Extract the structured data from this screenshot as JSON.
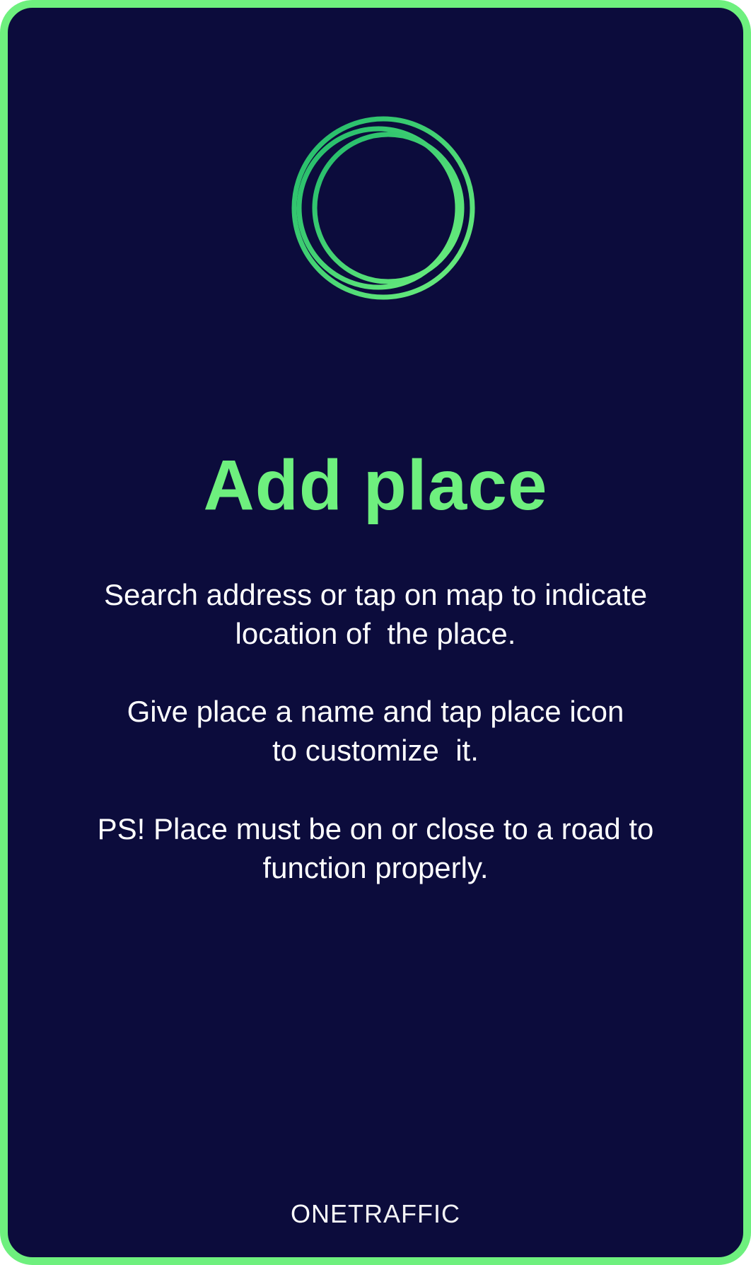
{
  "colors": {
    "accent": "#6ef07e",
    "background": "#0c0c3c",
    "text": "#ffffff",
    "ring": "#29d46e"
  },
  "logo_mark": {
    "icon": "concentric-rings-icon"
  },
  "title": "Add place",
  "paragraphs": [
    {
      "lines": [
        "Search address or tap on map to indicate",
        "location of  the place."
      ]
    },
    {
      "lines": [
        "Give place a name and tap place icon",
        "to customize  it."
      ]
    },
    {
      "lines": [
        "PS! Place must be on or close to a road to",
        "function properly."
      ]
    }
  ],
  "brand": {
    "part1": "ONE",
    "part2": "TRAFFIC"
  }
}
